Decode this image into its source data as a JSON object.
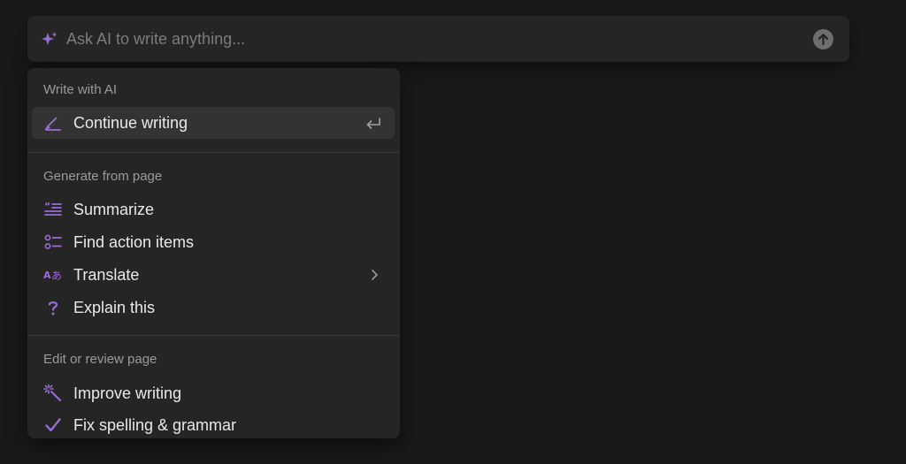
{
  "prompt_bar": {
    "placeholder": "Ask AI to write anything...",
    "value": "",
    "icon": "sparkle-icon",
    "send_icon": "arrow-up-icon"
  },
  "menu": {
    "sections": [
      {
        "title": "Write with AI",
        "items": [
          {
            "label": "Continue writing",
            "icon": "pencil-icon",
            "trailing": "enter-icon",
            "highlighted": true
          }
        ]
      },
      {
        "title": "Generate from page",
        "items": [
          {
            "label": "Summarize",
            "icon": "quote-lines-icon"
          },
          {
            "label": "Find action items",
            "icon": "checklist-icon"
          },
          {
            "label": "Translate",
            "icon": "translate-icon",
            "trailing": "chevron-right-icon"
          },
          {
            "label": "Explain this",
            "icon": "question-icon"
          }
        ]
      },
      {
        "title": "Edit or review page",
        "items": [
          {
            "label": "Improve writing",
            "icon": "magic-wand-icon"
          },
          {
            "label": "Fix spelling & grammar",
            "icon": "checkmark-icon"
          }
        ]
      }
    ]
  },
  "colors": {
    "background": "#191919",
    "surface": "#252525",
    "accent": "#9a6dd7",
    "text": "#e9e9e9",
    "muted": "#9b9b9b"
  }
}
